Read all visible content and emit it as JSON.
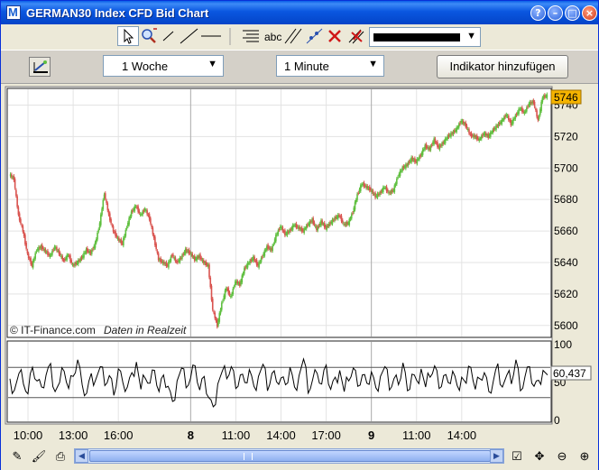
{
  "window": {
    "title": "GERMAN30 Index CFD Bid Chart",
    "app_icon_letter": "M",
    "controls": {
      "help": "?",
      "minimize": "–",
      "maximize": "□",
      "close": "×"
    }
  },
  "toolbar": {
    "text_tool_label": "abc",
    "line_color": "#000000"
  },
  "controls": {
    "period_select": "1 Woche",
    "interval_select": "1 Minute",
    "add_indicator_button": "Indikator hinzufügen"
  },
  "chart": {
    "watermark": "© IT-Finance.com",
    "realtime_label": "Daten in Realzeit",
    "last_price_label": "5746",
    "indicator_value_label": "60,437",
    "colors": {
      "up": "#5fbf3f",
      "down": "#d9534f",
      "grid": "#e3e3e3",
      "last_price_bg": "#f5b400"
    }
  },
  "chart_data": {
    "type": "line",
    "subtype": "candlestick",
    "price_axis": {
      "ticks": [
        "5740",
        "5720",
        "5700",
        "5680",
        "5660",
        "5640",
        "5620",
        "5600"
      ],
      "ylim": [
        5593,
        5750
      ]
    },
    "indicator_axis": {
      "ticks": [
        "100",
        "50",
        "0"
      ],
      "levels": [
        70,
        30
      ]
    },
    "x_ticks": [
      "10:00",
      "13:00",
      "16:00",
      "8",
      "11:00",
      "14:00",
      "17:00",
      "9",
      "11:00",
      "14:00"
    ],
    "day_separators": [
      "8",
      "9"
    ],
    "price_series": [
      5696,
      5693,
      5670,
      5660,
      5645,
      5638,
      5648,
      5650,
      5647,
      5644,
      5650,
      5646,
      5641,
      5645,
      5638,
      5640,
      5643,
      5648,
      5646,
      5652,
      5665,
      5684,
      5670,
      5660,
      5655,
      5652,
      5663,
      5672,
      5676,
      5670,
      5674,
      5668,
      5655,
      5642,
      5640,
      5638,
      5645,
      5640,
      5643,
      5648,
      5646,
      5642,
      5644,
      5640,
      5638,
      5610,
      5600,
      5614,
      5624,
      5618,
      5628,
      5626,
      5636,
      5640,
      5643,
      5638,
      5644,
      5650,
      5648,
      5657,
      5663,
      5658,
      5660,
      5664,
      5662,
      5660,
      5664,
      5667,
      5661,
      5666,
      5662,
      5665,
      5668,
      5670,
      5664,
      5665,
      5672,
      5683,
      5690,
      5688,
      5686,
      5682,
      5684,
      5688,
      5684,
      5686,
      5695,
      5700,
      5702,
      5706,
      5704,
      5708,
      5714,
      5712,
      5718,
      5713,
      5716,
      5720,
      5722,
      5725,
      5730,
      5727,
      5721,
      5720,
      5718,
      5722,
      5720,
      5724,
      5727,
      5730,
      5734,
      5728,
      5733,
      5738,
      5735,
      5741,
      5742,
      5730,
      5745,
      5746
    ],
    "indicator_series": [
      55,
      40,
      62,
      48,
      35,
      70,
      52,
      44,
      60,
      75,
      38,
      50,
      65,
      42,
      58,
      80,
      47,
      36,
      62,
      54,
      71,
      46,
      59,
      33,
      68,
      50,
      44,
      63,
      77,
      41,
      55,
      49,
      66,
      38,
      60,
      45,
      25,
      52,
      69,
      43,
      56,
      72,
      40,
      58,
      30,
      18,
      48,
      65,
      55,
      71,
      42,
      60,
      50,
      67,
      45,
      58,
      74,
      39,
      62,
      51,
      56,
      47,
      70,
      44,
      59,
      81,
      36,
      54,
      62,
      48,
      73,
      41,
      57,
      66,
      38,
      52,
      69,
      45,
      60,
      49,
      64,
      43,
      58,
      71,
      40,
      55,
      47,
      76,
      39,
      61,
      53,
      68,
      44,
      57,
      72,
      42,
      59,
      50,
      65,
      46,
      57,
      49,
      70,
      41,
      55,
      63,
      38,
      52,
      75,
      44,
      60,
      48,
      80,
      39,
      58,
      71,
      45,
      53,
      66,
      60
    ]
  }
}
